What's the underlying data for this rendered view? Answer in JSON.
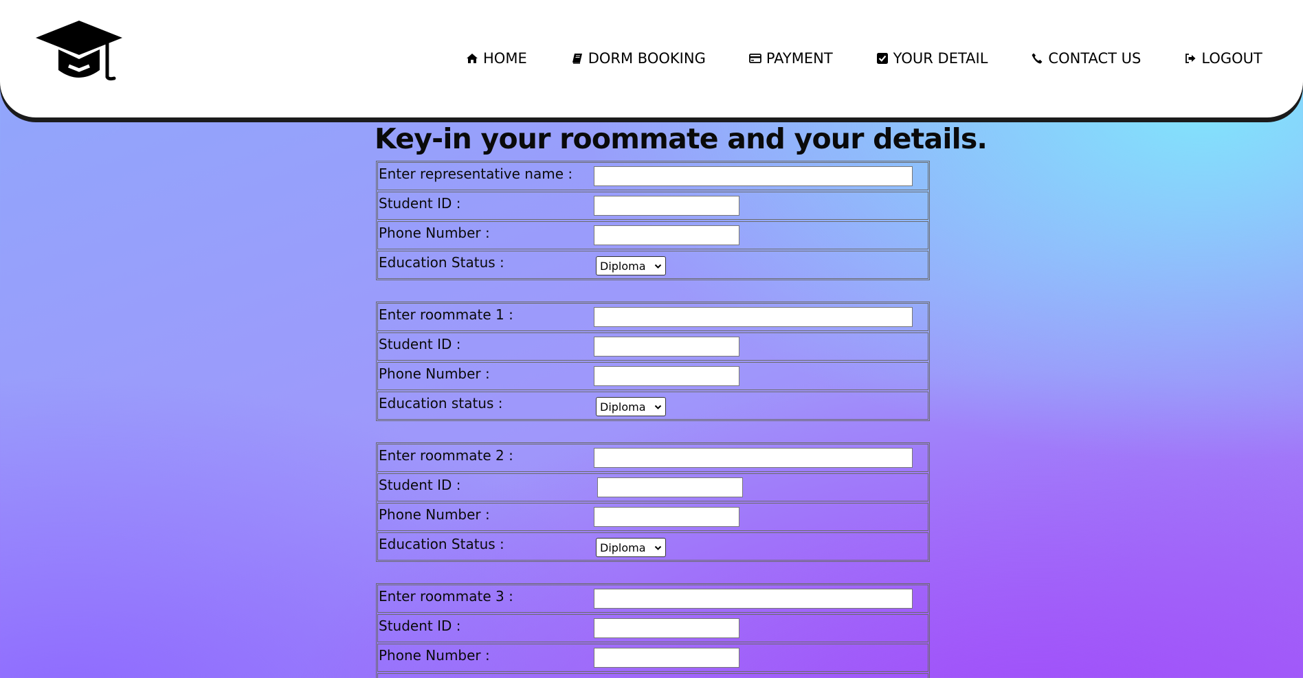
{
  "header": {
    "nav": [
      {
        "label": "HOME",
        "icon": "home-icon"
      },
      {
        "label": "DORM BOOKING",
        "icon": "book-icon"
      },
      {
        "label": "PAYMENT",
        "icon": "credit-card-icon"
      },
      {
        "label": "YOUR DETAIL",
        "icon": "check-square-icon"
      },
      {
        "label": "CONTACT US",
        "icon": "phone-icon"
      },
      {
        "label": "LOGOUT",
        "icon": "sign-out-icon"
      }
    ]
  },
  "main": {
    "title": "Key-in your roommate and your details.",
    "forms": [
      {
        "name_label": "Enter representative name :",
        "name_value": "",
        "id_label": "Student ID :",
        "id_value": "",
        "phone_label": "Phone Number :",
        "phone_value": "",
        "status_label": "Education Status :",
        "status_value": "Diploma"
      },
      {
        "name_label": "Enter roommate 1 :",
        "name_value": "",
        "id_label": "Student ID :",
        "id_value": "",
        "phone_label": "Phone Number :",
        "phone_value": "",
        "status_label": "Education status :",
        "status_value": "Diploma"
      },
      {
        "name_label": "Enter roommate 2 :",
        "name_value": "",
        "id_label": "Student ID :",
        "id_value": "",
        "phone_label": "Phone Number :",
        "phone_value": "",
        "status_label": "Education Status :",
        "status_value": "Diploma"
      },
      {
        "name_label": "Enter roommate 3 :",
        "name_value": "",
        "id_label": "Student ID :",
        "id_value": "",
        "phone_label": "Phone Number :",
        "phone_value": "",
        "status_label": "",
        "status_value": ""
      }
    ]
  }
}
